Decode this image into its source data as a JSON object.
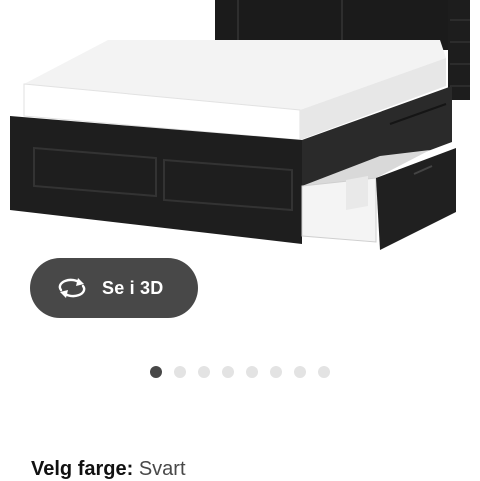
{
  "view3d": {
    "label": "Se i 3D",
    "icon": "rotate-arrows-icon"
  },
  "carousel": {
    "count": 8,
    "active_index": 0
  },
  "color": {
    "label": "Velg farge:",
    "value": "Svart"
  },
  "colors": {
    "accent": "#484848",
    "dot_inactive": "#e3e3e3",
    "product": "#1c1c1c"
  }
}
